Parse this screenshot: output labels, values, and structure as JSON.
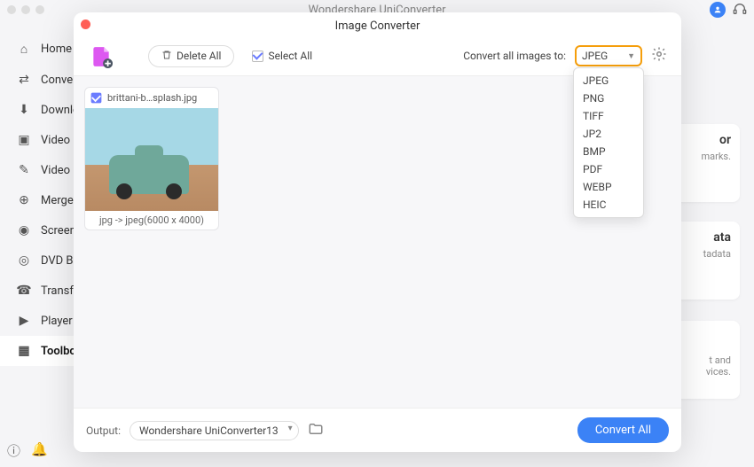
{
  "titlebar": {
    "title": "Wondershare UniConverter"
  },
  "sidebar": {
    "items": [
      {
        "label": "Home",
        "icon": "home"
      },
      {
        "label": "Converter",
        "icon": "convert"
      },
      {
        "label": "Downloader",
        "icon": "download"
      },
      {
        "label": "Video Compressor",
        "icon": "compress"
      },
      {
        "label": "Video Editor",
        "icon": "edit"
      },
      {
        "label": "Merger",
        "icon": "merge"
      },
      {
        "label": "Screen Recorder",
        "icon": "record"
      },
      {
        "label": "DVD Burner",
        "icon": "dvd"
      },
      {
        "label": "Transfer",
        "icon": "transfer"
      },
      {
        "label": "Player",
        "icon": "player"
      },
      {
        "label": "Toolbox",
        "icon": "toolbox",
        "selected": true
      }
    ]
  },
  "modal": {
    "title": "Image Converter",
    "toolbar": {
      "delete_all": "Delete All",
      "select_all": "Select All",
      "convert_to_label": "Convert all images to:",
      "format_selected": "JPEG",
      "format_options": [
        "JPEG",
        "PNG",
        "TIFF",
        "JP2",
        "BMP",
        "PDF",
        "WEBP",
        "HEIC"
      ]
    },
    "images": [
      {
        "filename": "brittani-b…splash.jpg",
        "conversion_info": "jpg -> jpeg(6000 x 4000)",
        "checked": true
      }
    ],
    "footer": {
      "output_label": "Output:",
      "output_path": "Wondershare UniConverter13",
      "convert_all": "Convert All"
    }
  },
  "bg_panels": {
    "card1_title": "or",
    "card1_sub": "marks.",
    "card2_title": "ata",
    "card2_sub": "tadata",
    "card3_sub1": "t and",
    "card3_sub2": "vices."
  }
}
